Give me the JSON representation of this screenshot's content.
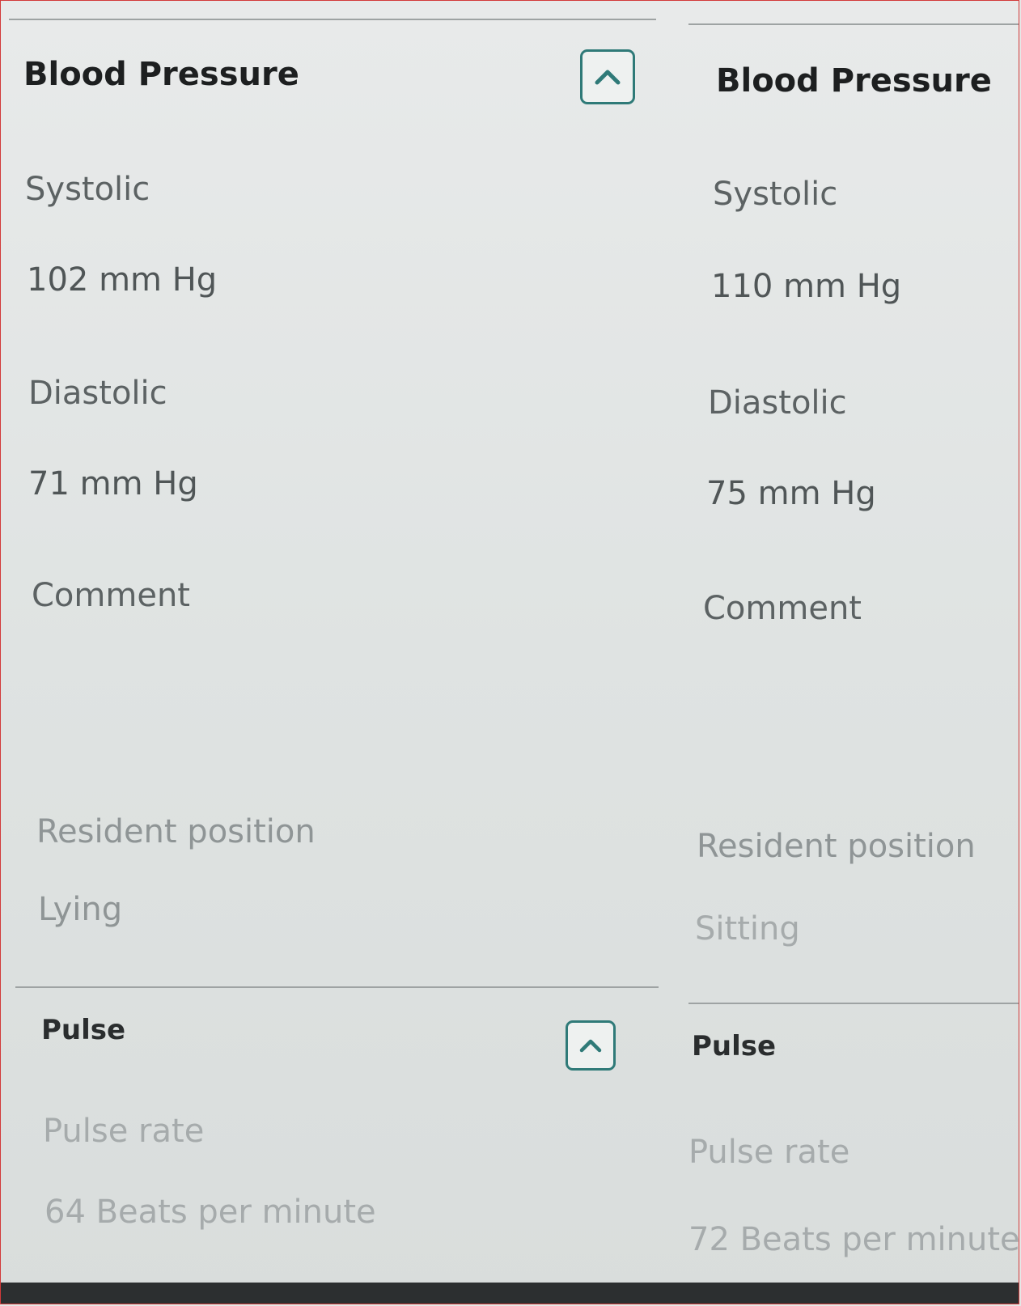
{
  "columns": [
    {
      "blood_pressure": {
        "title": "Blood Pressure",
        "systolic_label": "Systolic",
        "systolic_value": "102 mm Hg",
        "diastolic_label": "Diastolic",
        "diastolic_value": "71 mm Hg",
        "comment_label": "Comment",
        "position_label": "Resident position",
        "position_value": "Lying"
      },
      "pulse": {
        "title": "Pulse",
        "rate_label": "Pulse rate",
        "rate_value": "64 Beats per minute"
      },
      "collapse_icon": "chevron-up-icon"
    },
    {
      "blood_pressure": {
        "title": "Blood Pressure",
        "systolic_label": "Systolic",
        "systolic_value": "110 mm Hg",
        "diastolic_label": "Diastolic",
        "diastolic_value": "75 mm Hg",
        "comment_label": "Comment",
        "position_label": "Resident position",
        "position_value": "Sitting"
      },
      "pulse": {
        "title": "Pulse",
        "rate_label": "Pulse rate",
        "rate_value": "72 Beats per minute"
      }
    }
  ],
  "colors": {
    "accent": "#2f7a78",
    "background": "#e4e7e6",
    "text_dark": "#1d1f20",
    "text_muted": "#5c6263"
  }
}
